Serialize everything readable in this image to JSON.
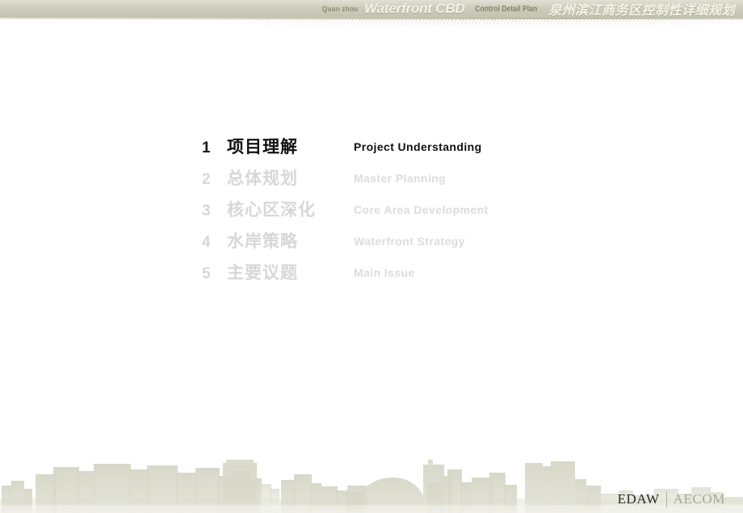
{
  "header": {
    "quanzhou": "Quan zhou",
    "waterfront_cbd": "Waterfront CBD",
    "control_detail_plan": "Control Detail Plan",
    "chinese_title": "泉州滨江商务区控制性详细规划",
    "band_color": "#cbcbb9"
  },
  "agenda": {
    "items": [
      {
        "num": "1",
        "cn": "项目理解",
        "en": "Project Understanding",
        "active": true
      },
      {
        "num": "2",
        "cn": "总体规划",
        "en": "Master Planning",
        "active": false
      },
      {
        "num": "3",
        "cn": "核心区深化",
        "en": "Core Area Development",
        "active": false
      },
      {
        "num": "4",
        "cn": "水岸策略",
        "en": "Waterfront  Strategy",
        "active": false
      },
      {
        "num": "5",
        "cn": "主要议题",
        "en": "Main Issue",
        "active": false
      }
    ],
    "active_color": "#111111",
    "inactive_color": "#d7d7d7"
  },
  "footer": {
    "logo_primary": "EDAW",
    "logo_secondary": "AECOM",
    "skyline_color": "#d5d6c6"
  }
}
